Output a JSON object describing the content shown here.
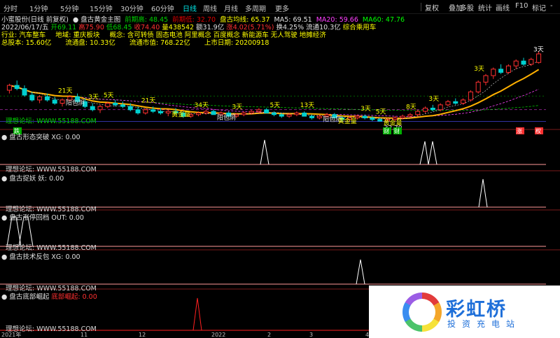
{
  "toolbar": {
    "timeframes": [
      "分时",
      "1分钟",
      "5分钟",
      "15分钟",
      "30分钟",
      "60分钟",
      "日线",
      "周线",
      "月线",
      "多周期",
      "更多"
    ],
    "active_timeframe": "日线",
    "buttons": [
      "复权",
      "叠加",
      "多股",
      "统计",
      "画线",
      "F10",
      "标记",
      "-"
    ]
  },
  "header": {
    "line1": [
      {
        "text": "小蜜股份(日线 前复权)",
        "color": "#e0e0e0"
      },
      {
        "text": "● 盘古黄金主图",
        "color": "#e0e0e0"
      },
      {
        "text": "前期高: 48.45",
        "color": "#00d000"
      },
      {
        "text": "前期低: 32.70",
        "color": "#e00000"
      },
      {
        "text": "盘古均线: 65.37",
        "color": "#ffff00"
      },
      {
        "text": "MA5: 69.51",
        "color": "#e0e0e0"
      },
      {
        "text": "MA20: 59.66",
        "color": "#ff40ff"
      },
      {
        "text": "MA60: 47.76",
        "color": "#00ff00"
      }
    ],
    "line2": [
      {
        "text": "2022/06/17/五",
        "color": "#e0e0e0"
      },
      {
        "text": "开69.11",
        "color": "#00d000"
      },
      {
        "text": "高75.90",
        "color": "#ff3030"
      },
      {
        "text": "低68.45",
        "color": "#00d000"
      },
      {
        "text": "收74.40",
        "color": "#ff3030"
      },
      {
        "text": "量438542",
        "color": "#ffff00"
      },
      {
        "text": "额31.9亿",
        "color": "#e0e0e0"
      },
      {
        "text": "涨4.02(5.71%)",
        "color": "#ff3030"
      },
      {
        "text": "换4.25%",
        "color": "#e0e0e0"
      },
      {
        "text": "流通10.3亿",
        "color": "#e0e0e0"
      },
      {
        "text": "综合乘用车",
        "color": "#ffff00"
      }
    ],
    "line3": [
      {
        "text": "行业: 汽车整车",
        "color": "#ffff00"
      },
      {
        "text": "地域: 重庆板块",
        "color": "#ffff00"
      },
      {
        "text": "概念: 含可转债 固态电池 阿里概念 百度概念 新能源车 无人驾驶 地摊经济",
        "color": "#ffff00"
      }
    ],
    "line4": [
      {
        "text": "总股本: 15.60亿",
        "color": "#ffff00"
      },
      {
        "text": "流通盘: 10.33亿",
        "color": "#ffff00"
      },
      {
        "text": "流通市值: 768.22亿",
        "color": "#ffff00"
      },
      {
        "text": "上市日期: 20200918",
        "color": "#ffff00"
      }
    ]
  },
  "main_labels": {
    "low_price": "32.70",
    "top_right_signal": "3天",
    "watermark_left": "理想论坛: WWW.55188.COM"
  },
  "bottom_tags": [
    {
      "text": "跌",
      "color": "#00b000"
    },
    {
      "text": "财",
      "color": "#00b000"
    },
    {
      "text": "财",
      "color": "#00b000"
    },
    {
      "text": "涨",
      "color": "#ff3030"
    },
    {
      "text": "权",
      "color": "#ff3030"
    }
  ],
  "indicators": [
    {
      "title": "盘古形态突破",
      "value": "XG: 0.00",
      "value_color": "#e0e0e0",
      "watermark": "理想论坛: WWW.55188.COM",
      "line_color": "#ffffff",
      "baseline_color": "#ff9999"
    },
    {
      "title": "盘古捉妖",
      "value": "妖: 0.00",
      "value_color": "#e0e0e0",
      "watermark": "理想论坛: WWW.55188.COM",
      "line_color": "#ffffff",
      "baseline_color": "#ff9999"
    },
    {
      "title": "盘古涨停回档",
      "value": "OUT: 0.00",
      "value_color": "#e0e0e0",
      "watermark": "理想论坛: WWW.55188.COM",
      "line_color": "#ffffff",
      "baseline_color": "#ff9999"
    },
    {
      "title": "盘古技术反包",
      "value": "XG: 0.00",
      "value_color": "#e0e0e0",
      "watermark": "理想论坛: WWW.55188.COM",
      "line_color": "#ffffff",
      "baseline_color": "#ff9999"
    },
    {
      "title": "盘古底部崛起",
      "value": "底部崛起: 0.00",
      "value_color": "#ff3030",
      "watermark": "理想论坛: WWW.55188.COM",
      "line_color": "#ff2020",
      "baseline_color": "#ff2020"
    }
  ],
  "x_axis_labels": [
    "2021年",
    "11",
    "12",
    "2022",
    "2",
    "3",
    "4",
    "5",
    "6"
  ],
  "logo": {
    "name": "彩虹桥",
    "subtitle": "投资充电站"
  },
  "chart_data": {
    "type": "candlestick",
    "price_range": [
      30,
      80
    ],
    "candles": [
      {
        "o": 52,
        "h": 56,
        "l": 50,
        "c": 55
      },
      {
        "o": 55,
        "h": 58,
        "l": 52,
        "c": 53
      },
      {
        "o": 53,
        "h": 55,
        "l": 48,
        "c": 49
      },
      {
        "o": 49,
        "h": 51,
        "l": 45,
        "c": 46
      },
      {
        "o": 46,
        "h": 49,
        "l": 44,
        "c": 48
      },
      {
        "o": 48,
        "h": 50,
        "l": 45,
        "c": 46
      },
      {
        "o": 46,
        "h": 48,
        "l": 43,
        "c": 44
      },
      {
        "o": 44,
        "h": 47,
        "l": 42,
        "c": 46
      },
      {
        "o": 46,
        "h": 49,
        "l": 45,
        "c": 48
      },
      {
        "o": 48,
        "h": 50,
        "l": 44,
        "c": 45
      },
      {
        "o": 45,
        "h": 47,
        "l": 41,
        "c": 42
      },
      {
        "o": 42,
        "h": 44,
        "l": 39,
        "c": 40
      },
      {
        "o": 40,
        "h": 43,
        "l": 38,
        "c": 42
      },
      {
        "o": 42,
        "h": 45,
        "l": 41,
        "c": 44
      },
      {
        "o": 44,
        "h": 46,
        "l": 42,
        "c": 43
      },
      {
        "o": 43,
        "h": 45,
        "l": 41,
        "c": 42
      },
      {
        "o": 42,
        "h": 44,
        "l": 39,
        "c": 40
      },
      {
        "o": 40,
        "h": 42,
        "l": 37,
        "c": 38
      },
      {
        "o": 38,
        "h": 41,
        "l": 37,
        "c": 40
      },
      {
        "o": 40,
        "h": 42,
        "l": 38,
        "c": 39
      },
      {
        "o": 39,
        "h": 41,
        "l": 37,
        "c": 38
      },
      {
        "o": 38,
        "h": 40,
        "l": 36,
        "c": 39
      },
      {
        "o": 39,
        "h": 41,
        "l": 37,
        "c": 38
      },
      {
        "o": 38,
        "h": 39,
        "l": 35,
        "c": 36
      },
      {
        "o": 36,
        "h": 38,
        "l": 35,
        "c": 37
      },
      {
        "o": 37,
        "h": 39,
        "l": 36,
        "c": 38
      },
      {
        "o": 38,
        "h": 40,
        "l": 37,
        "c": 39
      },
      {
        "o": 39,
        "h": 40,
        "l": 37,
        "c": 37
      },
      {
        "o": 37,
        "h": 39,
        "l": 36,
        "c": 38
      },
      {
        "o": 38,
        "h": 39,
        "l": 36,
        "c": 36
      },
      {
        "o": 36,
        "h": 38,
        "l": 35,
        "c": 37
      },
      {
        "o": 37,
        "h": 39,
        "l": 36,
        "c": 38
      },
      {
        "o": 38,
        "h": 40,
        "l": 37,
        "c": 39
      },
      {
        "o": 39,
        "h": 41,
        "l": 38,
        "c": 40
      },
      {
        "o": 40,
        "h": 41,
        "l": 38,
        "c": 38
      },
      {
        "o": 38,
        "h": 39,
        "l": 36,
        "c": 37
      },
      {
        "o": 37,
        "h": 38,
        "l": 35,
        "c": 36
      },
      {
        "o": 36,
        "h": 38,
        "l": 35,
        "c": 37
      },
      {
        "o": 37,
        "h": 39,
        "l": 36,
        "c": 38
      },
      {
        "o": 38,
        "h": 39,
        "l": 36,
        "c": 36
      },
      {
        "o": 36,
        "h": 37,
        "l": 34,
        "c": 35
      },
      {
        "o": 35,
        "h": 37,
        "l": 34,
        "c": 36
      },
      {
        "o": 36,
        "h": 38,
        "l": 35,
        "c": 37
      },
      {
        "o": 37,
        "h": 38,
        "l": 35,
        "c": 35
      },
      {
        "o": 35,
        "h": 36,
        "l": 33,
        "c": 34
      },
      {
        "o": 34,
        "h": 36,
        "l": 33,
        "c": 35
      },
      {
        "o": 35,
        "h": 37,
        "l": 34,
        "c": 36
      },
      {
        "o": 36,
        "h": 37,
        "l": 34,
        "c": 35
      },
      {
        "o": 35,
        "h": 36,
        "l": 33,
        "c": 34
      },
      {
        "o": 34,
        "h": 35,
        "l": 32.7,
        "c": 33
      },
      {
        "o": 33,
        "h": 35,
        "l": 32.7,
        "c": 34
      },
      {
        "o": 34,
        "h": 36,
        "l": 33,
        "c": 35
      },
      {
        "o": 35,
        "h": 37,
        "l": 34,
        "c": 36
      },
      {
        "o": 36,
        "h": 38,
        "l": 35,
        "c": 37
      },
      {
        "o": 37,
        "h": 40,
        "l": 36,
        "c": 39
      },
      {
        "o": 39,
        "h": 42,
        "l": 38,
        "c": 41
      },
      {
        "o": 41,
        "h": 43,
        "l": 39,
        "c": 40
      },
      {
        "o": 40,
        "h": 44,
        "l": 39,
        "c": 43
      },
      {
        "o": 43,
        "h": 46,
        "l": 42,
        "c": 45
      },
      {
        "o": 45,
        "h": 47,
        "l": 43,
        "c": 44
      },
      {
        "o": 44,
        "h": 47,
        "l": 43,
        "c": 46
      },
      {
        "o": 46,
        "h": 52,
        "l": 45,
        "c": 51
      },
      {
        "o": 51,
        "h": 58,
        "l": 50,
        "c": 57
      },
      {
        "o": 57,
        "h": 62,
        "l": 55,
        "c": 61
      },
      {
        "o": 61,
        "h": 66,
        "l": 59,
        "c": 65
      },
      {
        "o": 65,
        "h": 68,
        "l": 62,
        "c": 63
      },
      {
        "o": 63,
        "h": 68,
        "l": 62,
        "c": 67
      },
      {
        "o": 67,
        "h": 71,
        "l": 65,
        "c": 70
      },
      {
        "o": 70,
        "h": 72,
        "l": 67,
        "c": 68
      },
      {
        "o": 68,
        "h": 72,
        "l": 67,
        "c": 71
      },
      {
        "o": 69.11,
        "h": 75.9,
        "l": 68.45,
        "c": 74.4
      }
    ],
    "annotations": [
      "21天",
      "阳包阴",
      "3天",
      "5天",
      "21天",
      "黄金量",
      "34天",
      "阳包阴",
      "3天",
      "5天",
      "13天",
      "阳包阴",
      "黄金量",
      "3天",
      "5天",
      "黄金量",
      "8天",
      "3天",
      "3天"
    ]
  }
}
